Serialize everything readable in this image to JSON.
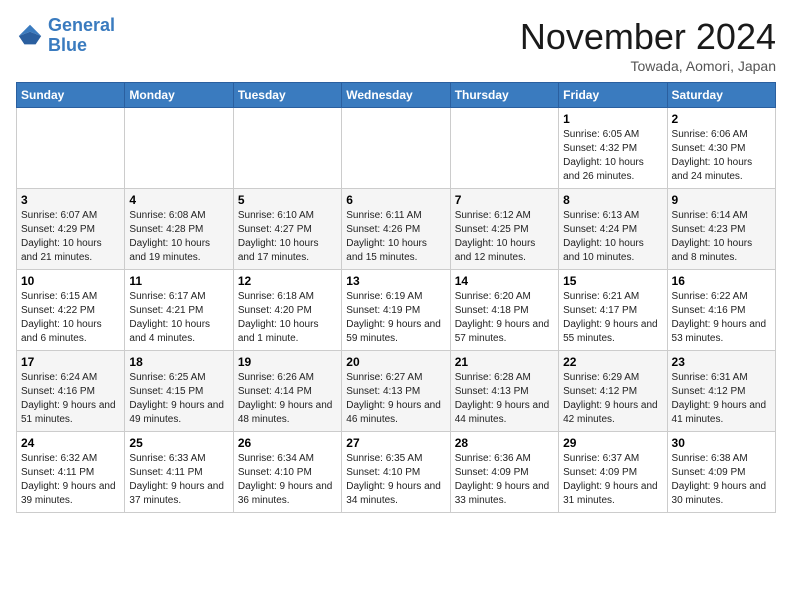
{
  "header": {
    "logo_text_general": "General",
    "logo_text_blue": "Blue",
    "month": "November 2024",
    "location": "Towada, Aomori, Japan"
  },
  "weekdays": [
    "Sunday",
    "Monday",
    "Tuesday",
    "Wednesday",
    "Thursday",
    "Friday",
    "Saturday"
  ],
  "weeks": [
    [
      {
        "day": "",
        "info": ""
      },
      {
        "day": "",
        "info": ""
      },
      {
        "day": "",
        "info": ""
      },
      {
        "day": "",
        "info": ""
      },
      {
        "day": "",
        "info": ""
      },
      {
        "day": "1",
        "info": "Sunrise: 6:05 AM\nSunset: 4:32 PM\nDaylight: 10 hours and 26 minutes."
      },
      {
        "day": "2",
        "info": "Sunrise: 6:06 AM\nSunset: 4:30 PM\nDaylight: 10 hours and 24 minutes."
      }
    ],
    [
      {
        "day": "3",
        "info": "Sunrise: 6:07 AM\nSunset: 4:29 PM\nDaylight: 10 hours and 21 minutes."
      },
      {
        "day": "4",
        "info": "Sunrise: 6:08 AM\nSunset: 4:28 PM\nDaylight: 10 hours and 19 minutes."
      },
      {
        "day": "5",
        "info": "Sunrise: 6:10 AM\nSunset: 4:27 PM\nDaylight: 10 hours and 17 minutes."
      },
      {
        "day": "6",
        "info": "Sunrise: 6:11 AM\nSunset: 4:26 PM\nDaylight: 10 hours and 15 minutes."
      },
      {
        "day": "7",
        "info": "Sunrise: 6:12 AM\nSunset: 4:25 PM\nDaylight: 10 hours and 12 minutes."
      },
      {
        "day": "8",
        "info": "Sunrise: 6:13 AM\nSunset: 4:24 PM\nDaylight: 10 hours and 10 minutes."
      },
      {
        "day": "9",
        "info": "Sunrise: 6:14 AM\nSunset: 4:23 PM\nDaylight: 10 hours and 8 minutes."
      }
    ],
    [
      {
        "day": "10",
        "info": "Sunrise: 6:15 AM\nSunset: 4:22 PM\nDaylight: 10 hours and 6 minutes."
      },
      {
        "day": "11",
        "info": "Sunrise: 6:17 AM\nSunset: 4:21 PM\nDaylight: 10 hours and 4 minutes."
      },
      {
        "day": "12",
        "info": "Sunrise: 6:18 AM\nSunset: 4:20 PM\nDaylight: 10 hours and 1 minute."
      },
      {
        "day": "13",
        "info": "Sunrise: 6:19 AM\nSunset: 4:19 PM\nDaylight: 9 hours and 59 minutes."
      },
      {
        "day": "14",
        "info": "Sunrise: 6:20 AM\nSunset: 4:18 PM\nDaylight: 9 hours and 57 minutes."
      },
      {
        "day": "15",
        "info": "Sunrise: 6:21 AM\nSunset: 4:17 PM\nDaylight: 9 hours and 55 minutes."
      },
      {
        "day": "16",
        "info": "Sunrise: 6:22 AM\nSunset: 4:16 PM\nDaylight: 9 hours and 53 minutes."
      }
    ],
    [
      {
        "day": "17",
        "info": "Sunrise: 6:24 AM\nSunset: 4:16 PM\nDaylight: 9 hours and 51 minutes."
      },
      {
        "day": "18",
        "info": "Sunrise: 6:25 AM\nSunset: 4:15 PM\nDaylight: 9 hours and 49 minutes."
      },
      {
        "day": "19",
        "info": "Sunrise: 6:26 AM\nSunset: 4:14 PM\nDaylight: 9 hours and 48 minutes."
      },
      {
        "day": "20",
        "info": "Sunrise: 6:27 AM\nSunset: 4:13 PM\nDaylight: 9 hours and 46 minutes."
      },
      {
        "day": "21",
        "info": "Sunrise: 6:28 AM\nSunset: 4:13 PM\nDaylight: 9 hours and 44 minutes."
      },
      {
        "day": "22",
        "info": "Sunrise: 6:29 AM\nSunset: 4:12 PM\nDaylight: 9 hours and 42 minutes."
      },
      {
        "day": "23",
        "info": "Sunrise: 6:31 AM\nSunset: 4:12 PM\nDaylight: 9 hours and 41 minutes."
      }
    ],
    [
      {
        "day": "24",
        "info": "Sunrise: 6:32 AM\nSunset: 4:11 PM\nDaylight: 9 hours and 39 minutes."
      },
      {
        "day": "25",
        "info": "Sunrise: 6:33 AM\nSunset: 4:11 PM\nDaylight: 9 hours and 37 minutes."
      },
      {
        "day": "26",
        "info": "Sunrise: 6:34 AM\nSunset: 4:10 PM\nDaylight: 9 hours and 36 minutes."
      },
      {
        "day": "27",
        "info": "Sunrise: 6:35 AM\nSunset: 4:10 PM\nDaylight: 9 hours and 34 minutes."
      },
      {
        "day": "28",
        "info": "Sunrise: 6:36 AM\nSunset: 4:09 PM\nDaylight: 9 hours and 33 minutes."
      },
      {
        "day": "29",
        "info": "Sunrise: 6:37 AM\nSunset: 4:09 PM\nDaylight: 9 hours and 31 minutes."
      },
      {
        "day": "30",
        "info": "Sunrise: 6:38 AM\nSunset: 4:09 PM\nDaylight: 9 hours and 30 minutes."
      }
    ]
  ]
}
